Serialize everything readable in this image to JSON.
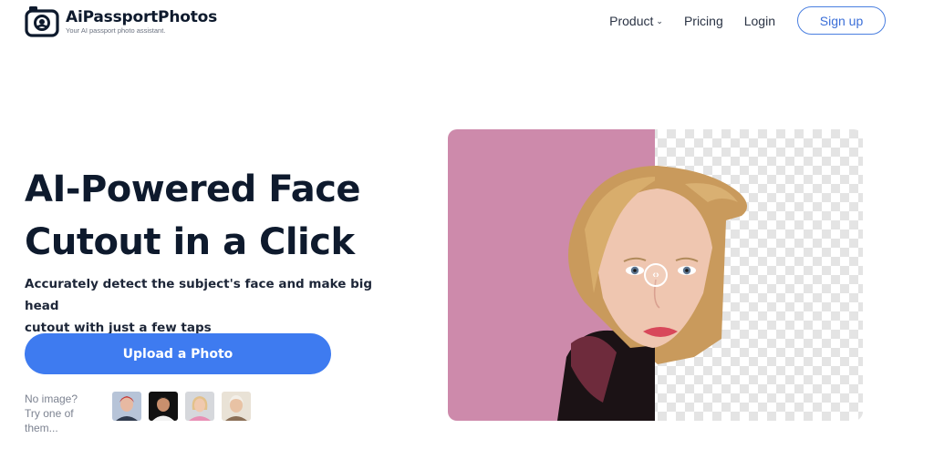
{
  "brand": {
    "name": "AiPassportPhotos",
    "tagline": "Your AI passport photo assistant."
  },
  "nav": {
    "product": "Product",
    "pricing": "Pricing",
    "login": "Login",
    "signup": "Sign up"
  },
  "hero": {
    "title_line1": "AI-Powered Face",
    "title_line2": "Cutout in a Click",
    "subtitle_line1": "Accurately detect the subject's face and make big head",
    "subtitle_line2": "cutout with just a few taps",
    "upload_button": "Upload a Photo"
  },
  "samples": {
    "prompt_line1": "No image?",
    "prompt_line2": "Try one of",
    "prompt_line3": "them...",
    "items": [
      "sample-1",
      "sample-2",
      "sample-3",
      "sample-4"
    ]
  },
  "compare": {
    "left_background": "#cd8aab",
    "handle_icon": "chevron-left-right-icon"
  },
  "colors": {
    "accent": "#3e7bf0",
    "heading": "#0e1a2d"
  }
}
